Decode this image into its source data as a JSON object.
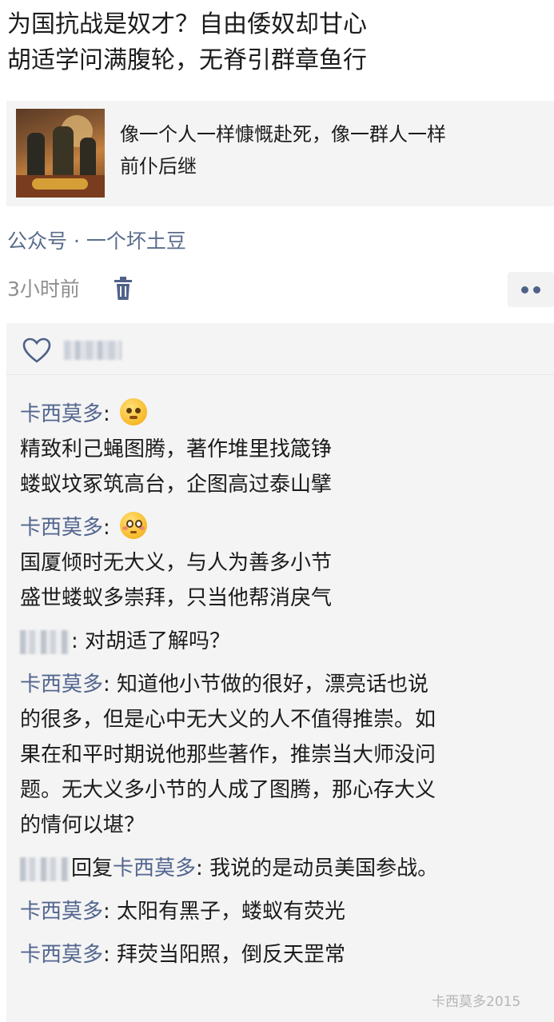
{
  "post": {
    "lines": [
      "为国抗战是奴才？自由倭奴却甘心",
      "胡适学问满腹轮，无脊引群章鱼行"
    ]
  },
  "link_card": {
    "title_lines": [
      "像一个人一样慷慨赴死，像一群人一样",
      "前仆后继"
    ],
    "thumbnail_icon": "painting-thumbnail"
  },
  "source": "公众号 · 一个坏土豆",
  "meta": {
    "time": "3小时前",
    "delete_icon": "trash-icon",
    "more_icon": "more-dots-icon"
  },
  "likes": {
    "icon": "heart-icon"
  },
  "comments": [
    {
      "author": "卡西莫多",
      "sep": ": ",
      "emoji": "shush-face",
      "lines": [
        "精致利己蝇图腾，著作堆里找箴铮",
        "蝼蚁坟冢筑高台，企图高过泰山擘"
      ]
    },
    {
      "author": "卡西莫多",
      "sep": ": ",
      "emoji": "flushed-face",
      "lines": [
        "国厦倾时无大义，与人为善多小节",
        "盛世蝼蚁多崇拜，只当他帮消戾气"
      ]
    },
    {
      "sep": ": ",
      "text": "对胡适了解吗？"
    },
    {
      "author": "卡西莫多",
      "sep": ": ",
      "lines": [
        "知道他小节做的很好，漂亮话也说",
        "的很多，但是心中无大义的人不值得推崇。如",
        "果在和平时期说他那些著作，推崇当大师没问",
        "题。无大义多小节的人成了图腾，那心存大义",
        "的情何以堪？"
      ]
    },
    {
      "reply_word": "回复",
      "reply_to": "卡西莫多",
      "sep": ": ",
      "text": "我说的是动员美国参战。"
    },
    {
      "author": "卡西莫多",
      "sep": ": ",
      "text": "太阳有黑子，蝼蚁有荧光"
    },
    {
      "author": "卡西莫多",
      "sep": ": ",
      "text": "拜荧当阳照，倒反天罡常"
    }
  ],
  "watermark": "卡西莫多2015",
  "colors": {
    "author": "#53668f",
    "source": "#5a6d8c",
    "card_bg": "#f4f4f4"
  }
}
